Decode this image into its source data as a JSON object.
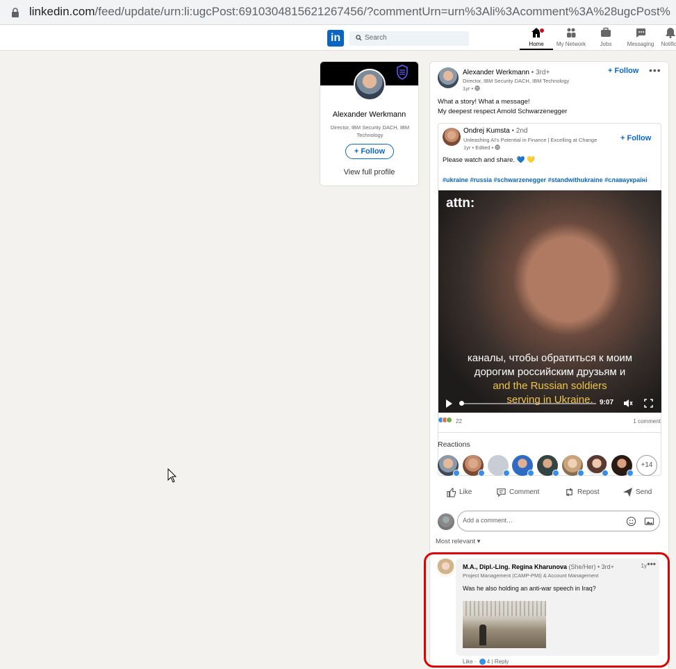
{
  "browser": {
    "url_host": "linkedin.com",
    "url_path": "/feed/update/urn:li:ugcPost:6910304815621267456/?commentUrn=urn%3Ali%3Acomment%3A%28ugcPost%"
  },
  "header": {
    "logo": "in",
    "search_placeholder": "Search",
    "nav": [
      {
        "label": "Home",
        "icon": "home-icon"
      },
      {
        "label": "My Network",
        "icon": "network-icon"
      },
      {
        "label": "Jobs",
        "icon": "briefcase-icon"
      },
      {
        "label": "Messaging",
        "icon": "message-icon"
      },
      {
        "label": "Notifica",
        "icon": "bell-icon"
      }
    ]
  },
  "profile_card": {
    "name": "Alexander Werkmann",
    "headline": "Director, IBM Security DACH, IBM Technology",
    "follow_label": "+ Follow",
    "view_profile": "View full profile"
  },
  "post": {
    "author": "Alexander Werkmann",
    "degree": " • 3rd+",
    "headline": "Director, IBM Security DACH, IBM Technology",
    "time": "1yr •",
    "follow_label": "+ Follow",
    "text_line1": "What a story! What a message!",
    "text_line2": "My deepest respect Arnold Schwarzenegger",
    "shared": {
      "author": "Ondrej Kumsta",
      "degree": " • 2nd",
      "headline": "Unleashing AI's Potential in Finance | Excelling at Change",
      "time": "1yr • Edited •",
      "follow_label": "+ Follow",
      "text": "Please watch and share. 💙 💛",
      "hashtags": "#ukraine #russia #schwarzenegger #standwithukraine #славаукраїні",
      "video": {
        "brand": "attn:",
        "subtitle_lines": [
          "каналы, чтобы обратиться к моим",
          "дорогим российским друзьям и",
          "and the Russian soldiers",
          "serving in Ukraine."
        ],
        "time": "9:07"
      }
    },
    "reaction_count": "22",
    "comment_count": "1 comment",
    "reactions_title": "Reactions",
    "more_reactors": "+14",
    "actions": [
      "Like",
      "Comment",
      "Repost",
      "Send"
    ],
    "comment_placeholder": "Add a comment…",
    "sort_label": "Most relevant ▾"
  },
  "comment": {
    "name": "M.A., Dipl.-Ling. Regina Kharunova",
    "pronouns": " (She/Her) • 3rd+",
    "headline": "Project Management (CAMP-PMI) & Account Management",
    "time": "1y",
    "text": "Was he also holding an anti-war speech in Iraq?",
    "like_label": "Like",
    "like_count": "4",
    "reply_label": "Reply"
  },
  "colors": {
    "linkedin_blue": "#0a66c2",
    "highlight_red": "#e00000",
    "page_bg": "#f3f2ef"
  }
}
